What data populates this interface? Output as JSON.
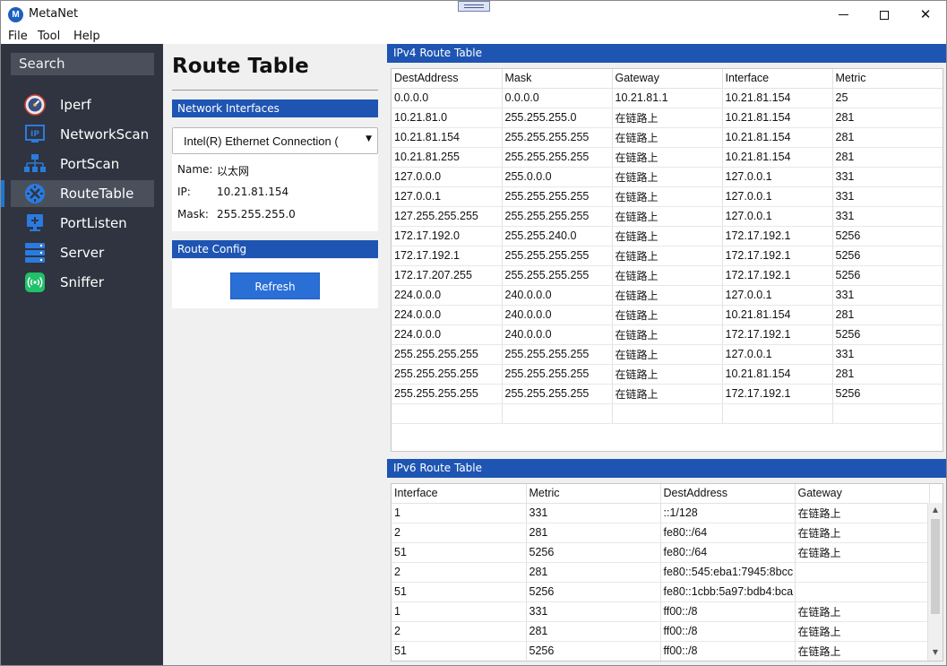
{
  "app": {
    "title": "MetaNet",
    "logo_letter": "M"
  },
  "window_controls": {
    "minimize": "minimize",
    "maximize": "maximize",
    "close": "✕"
  },
  "menu": [
    "File",
    "Tool",
    "Help"
  ],
  "sidebar": {
    "search_label": "Search",
    "items": [
      {
        "label": "Iperf",
        "icon": "speedometer-icon",
        "active": false
      },
      {
        "label": "NetworkScan",
        "icon": "ip-icon",
        "active": false
      },
      {
        "label": "PortScan",
        "icon": "network-tree-icon",
        "active": false
      },
      {
        "label": "RouteTable",
        "icon": "route-icon",
        "active": true
      },
      {
        "label": "PortListen",
        "icon": "monitor-plus-icon",
        "active": false
      },
      {
        "label": "Server",
        "icon": "server-icon",
        "active": false
      },
      {
        "label": "Sniffer",
        "icon": "wifi-signal-icon",
        "active": false
      }
    ]
  },
  "main": {
    "title": "Route Table",
    "network_interfaces": {
      "header": "Network Interfaces",
      "selected_interface": "Intel(R) Ethernet Connection (",
      "name_label": "Name:",
      "name_value": "以太网",
      "ip_label": "IP:",
      "ip_value": "10.21.81.154",
      "mask_label": "Mask:",
      "mask_value": "255.255.255.0"
    },
    "route_config": {
      "header": "Route Config",
      "refresh_label": "Refresh"
    }
  },
  "ipv4": {
    "header": "IPv4 Route Table",
    "columns": [
      "DestAddress",
      "Mask",
      "Gateway",
      "Interface",
      "Metric"
    ],
    "rows": [
      [
        "0.0.0.0",
        "0.0.0.0",
        "10.21.81.1",
        "10.21.81.154",
        "25"
      ],
      [
        "10.21.81.0",
        "255.255.255.0",
        "在链路上",
        "10.21.81.154",
        "281"
      ],
      [
        "10.21.81.154",
        "255.255.255.255",
        "在链路上",
        "10.21.81.154",
        "281"
      ],
      [
        "10.21.81.255",
        "255.255.255.255",
        "在链路上",
        "10.21.81.154",
        "281"
      ],
      [
        "127.0.0.0",
        "255.0.0.0",
        "在链路上",
        "127.0.0.1",
        "331"
      ],
      [
        "127.0.0.1",
        "255.255.255.255",
        "在链路上",
        "127.0.0.1",
        "331"
      ],
      [
        "127.255.255.255",
        "255.255.255.255",
        "在链路上",
        "127.0.0.1",
        "331"
      ],
      [
        "172.17.192.0",
        "255.255.240.0",
        "在链路上",
        "172.17.192.1",
        "5256"
      ],
      [
        "172.17.192.1",
        "255.255.255.255",
        "在链路上",
        "172.17.192.1",
        "5256"
      ],
      [
        "172.17.207.255",
        "255.255.255.255",
        "在链路上",
        "172.17.192.1",
        "5256"
      ],
      [
        "224.0.0.0",
        "240.0.0.0",
        "在链路上",
        "127.0.0.1",
        "331"
      ],
      [
        "224.0.0.0",
        "240.0.0.0",
        "在链路上",
        "10.21.81.154",
        "281"
      ],
      [
        "224.0.0.0",
        "240.0.0.0",
        "在链路上",
        "172.17.192.1",
        "5256"
      ],
      [
        "255.255.255.255",
        "255.255.255.255",
        "在链路上",
        "127.0.0.1",
        "331"
      ],
      [
        "255.255.255.255",
        "255.255.255.255",
        "在链路上",
        "10.21.81.154",
        "281"
      ],
      [
        "255.255.255.255",
        "255.255.255.255",
        "在链路上",
        "172.17.192.1",
        "5256"
      ]
    ]
  },
  "ipv6": {
    "header": "IPv6 Route Table",
    "columns": [
      "Interface",
      "Metric",
      "DestAddress",
      "Gateway"
    ],
    "rows": [
      [
        "1",
        "331",
        "::1/128",
        "在链路上"
      ],
      [
        "2",
        "281",
        "fe80::/64",
        "在链路上"
      ],
      [
        "51",
        "5256",
        "fe80::/64",
        "在链路上"
      ],
      [
        "2",
        "281",
        "fe80::545:eba1:7945:8bcc",
        ""
      ],
      [
        "51",
        "5256",
        "fe80::1cbb:5a97:bdb4:bca",
        ""
      ],
      [
        "1",
        "331",
        "ff00::/8",
        "在链路上"
      ],
      [
        "2",
        "281",
        "ff00::/8",
        "在链路上"
      ],
      [
        "51",
        "5256",
        "ff00::/8",
        "在链路上"
      ]
    ]
  },
  "colors": {
    "sidebar_bg": "#2f3440",
    "header_blue": "#1e55b3",
    "active_accent": "#1e78d2",
    "button_blue": "#2a6fd6"
  }
}
